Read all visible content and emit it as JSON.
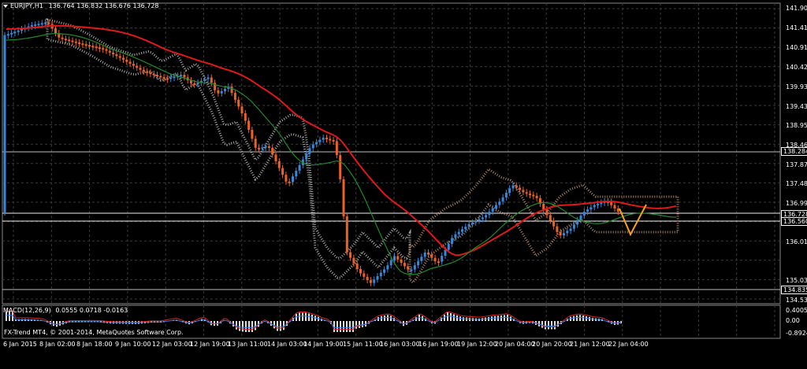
{
  "main_header": {
    "symbol": "EURJPY,H1",
    "ohlc": "136.764 136.832 136.676 136.728"
  },
  "macd_header": {
    "label": "MACD(12,26,9)",
    "values": "0.0555 0.0718 -0.0163"
  },
  "copyright": "FX-Trend MT4, © 2001-2014, MetaQuotes Software Corp.",
  "price_axis": [
    "141.900",
    "141.410",
    "140.910",
    "140.420",
    "139.934",
    "139.430",
    "138.950",
    "138.460",
    "137.870",
    "137.480",
    "136.990",
    "136.010",
    "135.030",
    "134.530"
  ],
  "price_boxes": [
    "138.284",
    "136.728",
    "136.560",
    "134.835"
  ],
  "macd_axis": [
    "0.4005",
    "0.00",
    "-0.8924"
  ],
  "time_axis": [
    "6 Jan 2015",
    "8 Jan 02:00",
    "8 Jan 18:00",
    "9 Jan 10:00",
    "12 Jan 03:00",
    "12 Jan 19:00",
    "13 Jan 11:00",
    "14 Jan 03:00",
    "14 Jan 19:00",
    "15 Jan 11:00",
    "16 Jan 03:00",
    "16 Jan 19:00",
    "19 Jan 12:00",
    "20 Jan 04:00",
    "20 Jan 20:00",
    "21 Jan 12:00",
    "22 Jan 04:00"
  ],
  "colors": {
    "background": "#000000",
    "grid": "#3a3a3a",
    "bull_candle": "#3a86d8",
    "bear_candle": "#e8622a",
    "ma_red": "#e01818",
    "ma_green": "#1f8a2a",
    "cloud_light": "#c9c9c9",
    "cloud_peach": "#e7b48a",
    "macd_line": "#e02020",
    "signal_line": "#2f7be0"
  }
}
